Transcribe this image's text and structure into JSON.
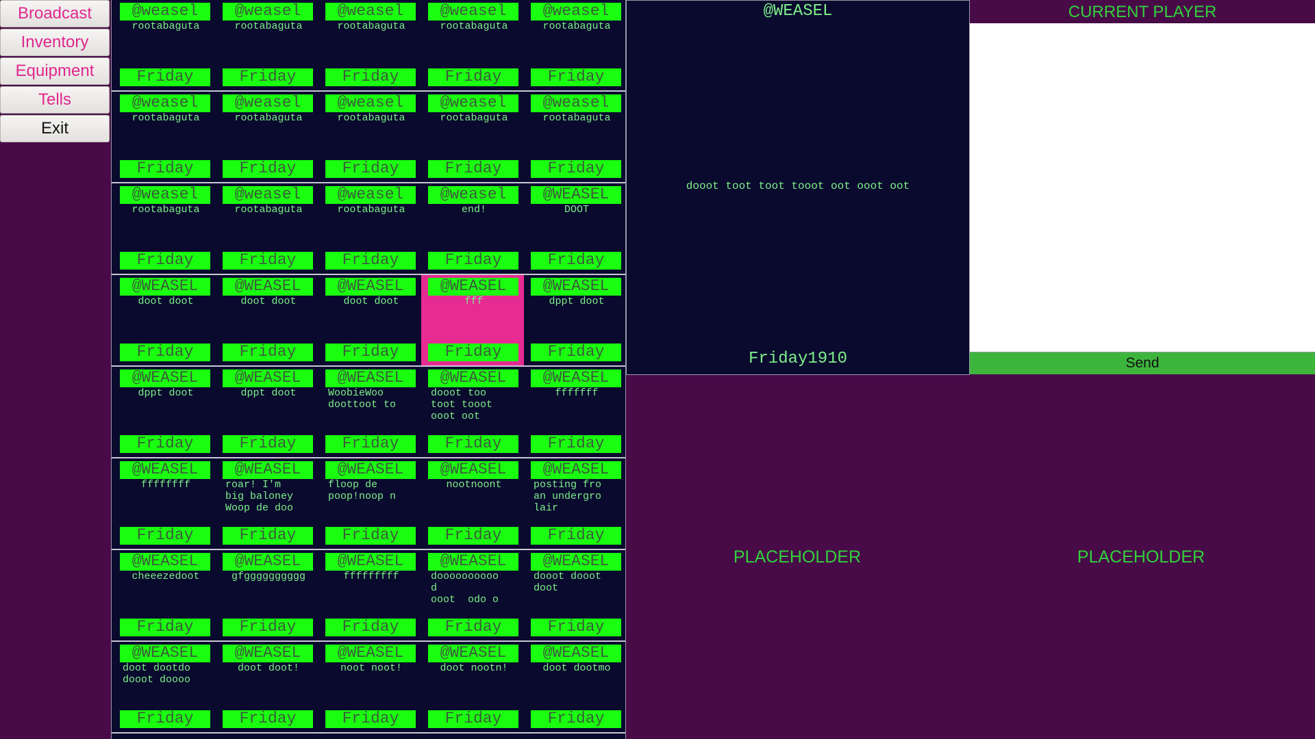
{
  "menu": {
    "items": [
      {
        "label": "Broadcast",
        "style": "pink"
      },
      {
        "label": "Inventory",
        "style": "pink"
      },
      {
        "label": "Equipment",
        "style": "pink"
      },
      {
        "label": "Tells",
        "style": "pink"
      },
      {
        "label": "Exit",
        "style": "plain"
      }
    ]
  },
  "grid": {
    "rows": [
      [
        {
          "handle": "@weasel",
          "text": "rootabaguta",
          "day": "Friday"
        },
        {
          "handle": "@weasel",
          "text": "rootabaguta",
          "day": "Friday"
        },
        {
          "handle": "@weasel",
          "text": "rootabaguta",
          "day": "Friday"
        },
        {
          "handle": "@weasel",
          "text": "rootabaguta",
          "day": "Friday"
        },
        {
          "handle": "@weasel",
          "text": "rootabaguta",
          "day": "Friday"
        }
      ],
      [
        {
          "handle": "@weasel",
          "text": "rootabaguta",
          "day": "Friday"
        },
        {
          "handle": "@weasel",
          "text": "rootabaguta",
          "day": "Friday"
        },
        {
          "handle": "@weasel",
          "text": "rootabaguta",
          "day": "Friday"
        },
        {
          "handle": "@weasel",
          "text": "rootabaguta",
          "day": "Friday"
        },
        {
          "handle": "@weasel",
          "text": "rootabaguta",
          "day": "Friday"
        }
      ],
      [
        {
          "handle": "@weasel",
          "text": "rootabaguta",
          "day": "Friday"
        },
        {
          "handle": "@weasel",
          "text": "rootabaguta",
          "day": "Friday"
        },
        {
          "handle": "@weasel",
          "text": "rootabaguta",
          "day": "Friday"
        },
        {
          "handle": "@weasel",
          "text": "end!",
          "day": "Friday"
        },
        {
          "handle": "@WEASEL",
          "text": "DOOT",
          "day": "Friday"
        }
      ],
      [
        {
          "handle": "@WEASEL",
          "text": "doot doot",
          "day": "Friday"
        },
        {
          "handle": "@WEASEL",
          "text": "doot doot",
          "day": "Friday"
        },
        {
          "handle": "@WEASEL",
          "text": "doot doot",
          "day": "Friday"
        },
        {
          "handle": "@WEASEL",
          "text": "fff",
          "day": "Friday",
          "selected": true
        },
        {
          "handle": "@WEASEL",
          "text": "dppt doot",
          "day": "Friday"
        }
      ],
      [
        {
          "handle": "@WEASEL",
          "text": "dppt doot",
          "day": "Friday"
        },
        {
          "handle": "@WEASEL",
          "text": "dppt doot",
          "day": "Friday"
        },
        {
          "handle": "@WEASEL",
          "text": "WoobieWoo\ndoottoot to",
          "day": "Friday"
        },
        {
          "handle": "@WEASEL",
          "text": "dooot too\ntoot tooot\nooot oot",
          "day": "Friday"
        },
        {
          "handle": "@WEASEL",
          "text": "fffffff",
          "day": "Friday"
        }
      ],
      [
        {
          "handle": "@WEASEL",
          "text": "ffffffff",
          "day": "Friday"
        },
        {
          "handle": "@WEASEL",
          "text": "roar! I'm\nbig baloney\nWoop de doo",
          "day": "Friday"
        },
        {
          "handle": "@WEASEL",
          "text": "floop de\npoop!noop n",
          "day": "Friday"
        },
        {
          "handle": "@WEASEL",
          "text": "nootnoont",
          "day": "Friday"
        },
        {
          "handle": "@WEASEL",
          "text": "posting fro\nan undergro\nlair",
          "day": "Friday"
        }
      ],
      [
        {
          "handle": "@WEASEL",
          "text": "cheeezedoot",
          "day": "Friday"
        },
        {
          "handle": "@WEASEL",
          "text": "gfgggggggggg",
          "day": "Friday"
        },
        {
          "handle": "@WEASEL",
          "text": "fffffffff",
          "day": "Friday"
        },
        {
          "handle": "@WEASEL",
          "text": "doooooooooo\nd\nooot  odo o",
          "day": "Friday"
        },
        {
          "handle": "@WEASEL",
          "text": "dooot dooot\ndoot",
          "day": "Friday"
        }
      ],
      [
        {
          "handle": "@WEASEL",
          "text": "doot dootdo\ndooot doooo",
          "day": "Friday"
        },
        {
          "handle": "@WEASEL",
          "text": "doot doot!",
          "day": "Friday"
        },
        {
          "handle": "@WEASEL",
          "text": "noot noot!",
          "day": "Friday"
        },
        {
          "handle": "@WEASEL",
          "text": "doot nootn!",
          "day": "Friday"
        },
        {
          "handle": "@WEASEL",
          "text": "doot dootmo",
          "day": "Friday"
        }
      ]
    ]
  },
  "detail": {
    "handle": "@WEASEL",
    "body": "dooot toot toot tooot oot ooot oot",
    "footer": "Friday1910"
  },
  "player": {
    "title": "CURRENT PLAYER",
    "input_value": "",
    "send_label": "Send"
  },
  "placeholders": [
    "PLACEHOLDER",
    "PLACEHOLDER"
  ],
  "colors": {
    "background": "#480b48",
    "panel": "#0a0a2e",
    "green_bar": "#1aff0f",
    "green_text": "#7ef08a",
    "accent_pink": "#e0288e",
    "selected_cell": "#e62b93",
    "send_green": "#3db53d"
  }
}
